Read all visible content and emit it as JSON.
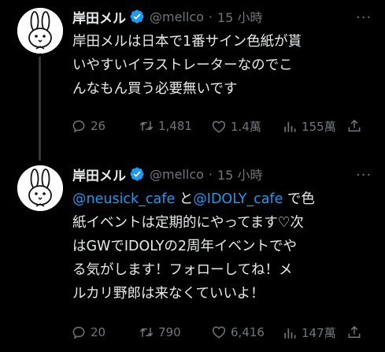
{
  "colors": {
    "background": "#000000",
    "text": "#e7e9ea",
    "secondary": "#71767b",
    "accent": "#1d9bf0"
  },
  "tweets": [
    {
      "author": {
        "name": "岸田メル",
        "handle": "@mellco",
        "dot": "·",
        "time": "15 小時",
        "verified_icon": "verified-badge-icon",
        "avatar_icon": "bunny-avatar-icon"
      },
      "more": "···",
      "body_lines": [
        "岸田メルは日本で1番サイン色紙が貰",
        "いやすいイラストレーターなのでこ",
        "んなもん買う必要無いです"
      ],
      "stats": {
        "replies": "26",
        "retweets": "1,481",
        "likes": "1.4萬",
        "views": "155萬"
      }
    },
    {
      "author": {
        "name": "岸田メル",
        "handle": "@mellco",
        "dot": "·",
        "time": "15 小時",
        "verified_icon": "verified-badge-icon",
        "avatar_icon": "bunny-avatar-icon"
      },
      "more": "···",
      "body": {
        "mention1": "@neusick_cafe",
        "connector": " と",
        "mention2": "@IDOLY_cafe",
        "line1_rest": " で色",
        "lines": [
          "紙イベントは定期的にやってます♡次",
          "はGWでIDOLYの2周年イベントでや",
          "る気がします！フォローしてね！メ",
          "ルカリ野郎は来なくていいよ！"
        ]
      },
      "stats": {
        "replies": "20",
        "retweets": "790",
        "likes": "6,416",
        "views": "147萬"
      }
    }
  ]
}
